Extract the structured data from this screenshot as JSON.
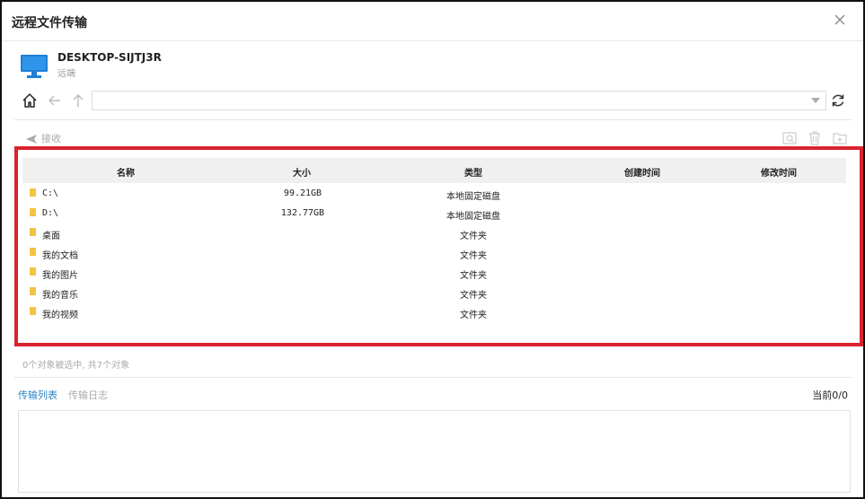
{
  "window": {
    "title": "远程文件传输"
  },
  "device": {
    "name": "DESKTOP-SIJTJ3R",
    "role": "远端"
  },
  "navigation": {
    "path_value": ""
  },
  "toolbar": {
    "receive_label": "接收"
  },
  "table": {
    "headers": [
      "名称",
      "大小",
      "类型",
      "创建时间",
      "修改时间"
    ],
    "rows": [
      {
        "name": "C:\\",
        "size": "99.21GB",
        "type": "本地固定磁盘",
        "created": "",
        "modified": ""
      },
      {
        "name": "D:\\",
        "size": "132.77GB",
        "type": "本地固定磁盘",
        "created": "",
        "modified": ""
      },
      {
        "name": "桌面",
        "size": "",
        "type": "文件夹",
        "created": "",
        "modified": ""
      },
      {
        "name": "我的文档",
        "size": "",
        "type": "文件夹",
        "created": "",
        "modified": ""
      },
      {
        "name": "我的图片",
        "size": "",
        "type": "文件夹",
        "created": "",
        "modified": ""
      },
      {
        "name": "我的音乐",
        "size": "",
        "type": "文件夹",
        "created": "",
        "modified": ""
      },
      {
        "name": "我的视频",
        "size": "",
        "type": "文件夹",
        "created": "",
        "modified": ""
      }
    ]
  },
  "status": {
    "selection_text": "0个对象被选中, 共7个对象"
  },
  "transfer": {
    "tabs": [
      {
        "label": "传输列表",
        "active": true
      },
      {
        "label": "传输日志",
        "active": false
      }
    ],
    "counter": "当前0/0"
  },
  "colors": {
    "accent": "#2f86c5",
    "highlight_border": "#d9232d",
    "folder": "#f4c343",
    "monitor": "#1e7fd6"
  }
}
